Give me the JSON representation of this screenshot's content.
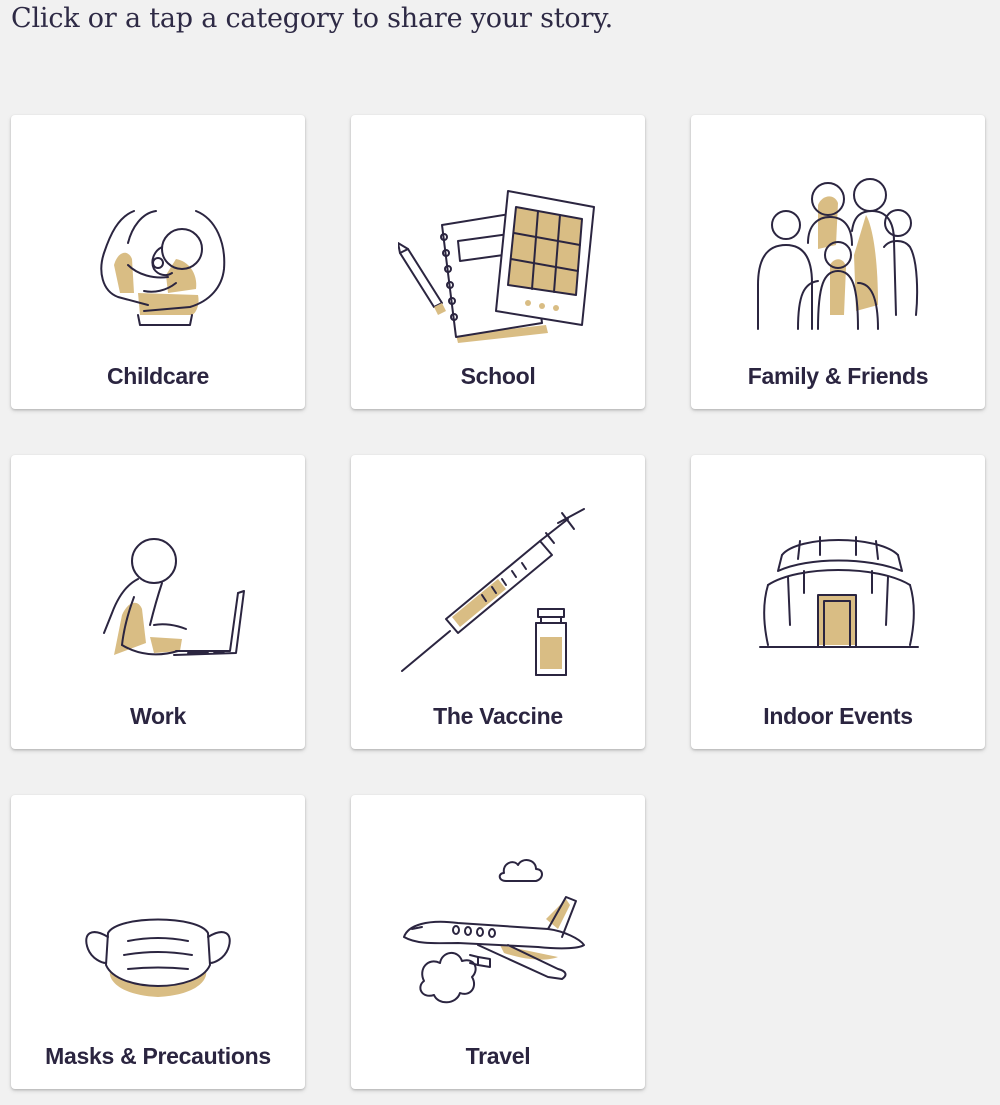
{
  "instructions": "Click or a tap a category to share your story.",
  "categories": [
    {
      "label": "Childcare",
      "icon": "baby-in-arms-icon"
    },
    {
      "label": "School",
      "icon": "notebook-tablet-pencil-icon"
    },
    {
      "label": "Family & Friends",
      "icon": "group-of-people-icon"
    },
    {
      "label": "Work",
      "icon": "person-at-laptop-icon"
    },
    {
      "label": "The Vaccine",
      "icon": "syringe-vial-icon"
    },
    {
      "label": "Indoor Events",
      "icon": "stadium-icon"
    },
    {
      "label": "Masks & Precautions",
      "icon": "face-mask-icon"
    },
    {
      "label": "Travel",
      "icon": "airplane-clouds-icon"
    }
  ],
  "colors": {
    "background": "#f1f1f1",
    "card": "#ffffff",
    "ink": "#2b2540",
    "accent_gold": "#d9bd84"
  }
}
